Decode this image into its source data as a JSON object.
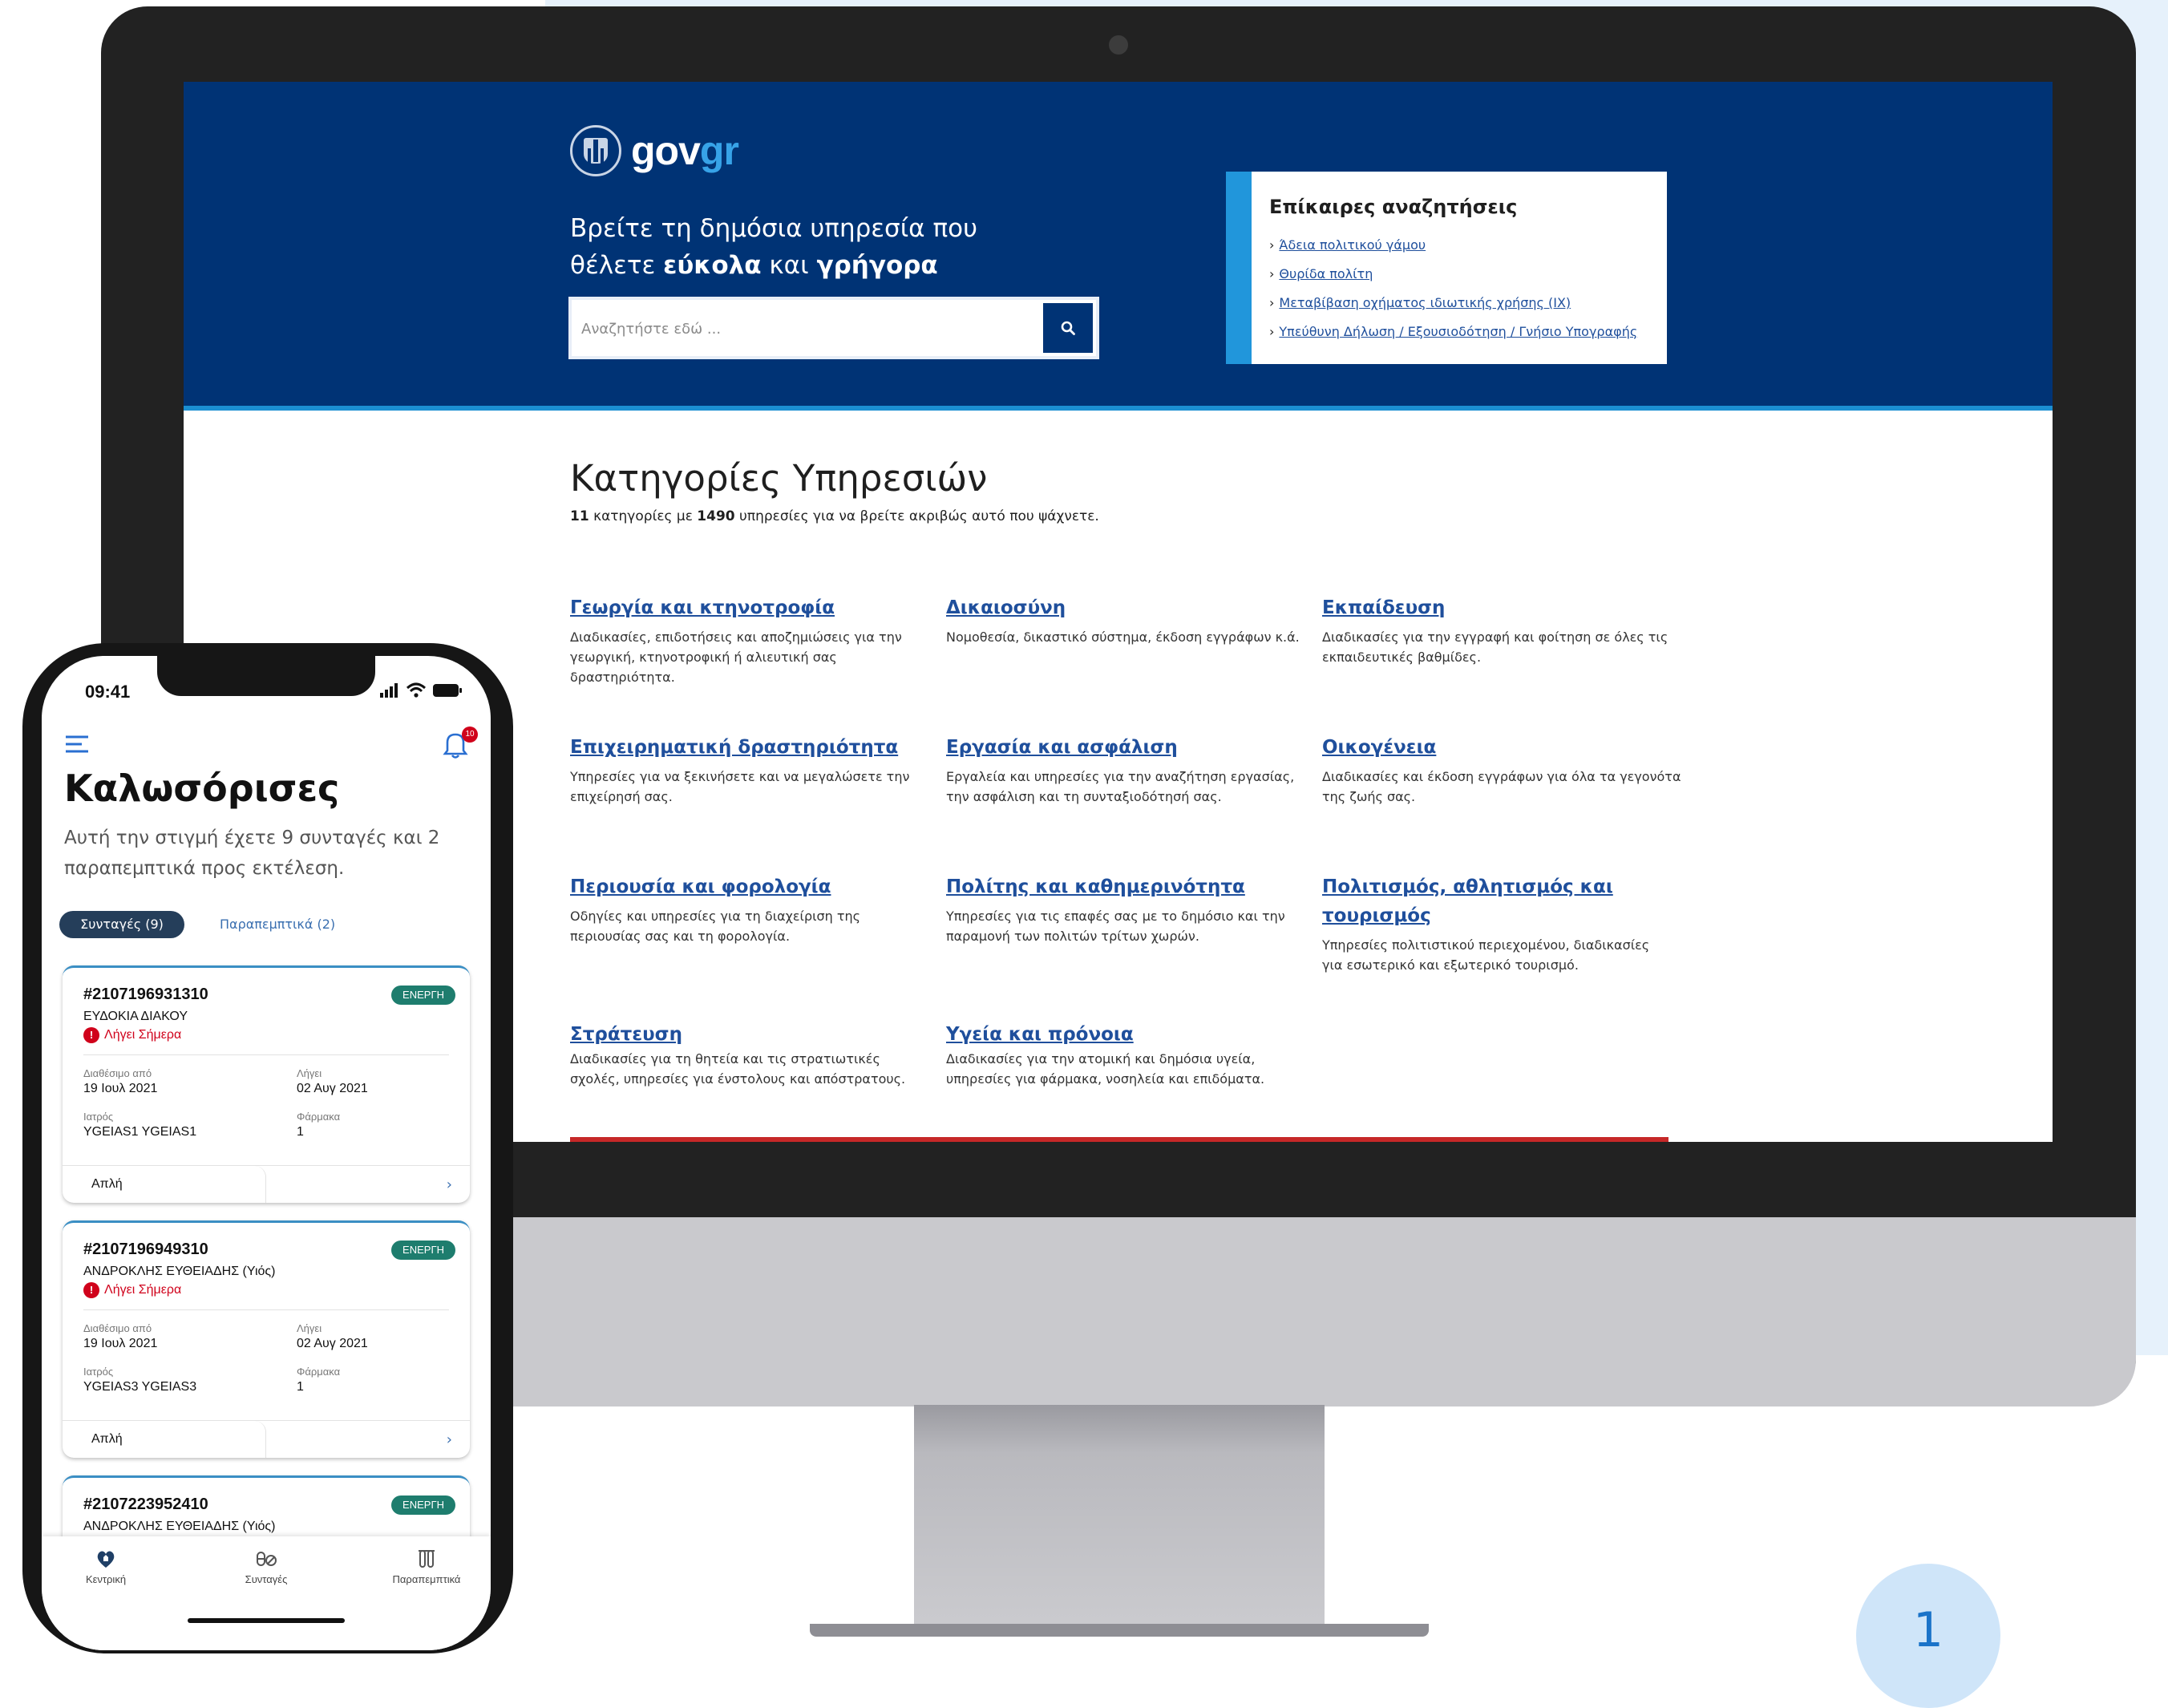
{
  "page_number": "1",
  "desktop": {
    "logo": {
      "gov": "gov",
      "gr": "gr"
    },
    "hero": {
      "line1": "Βρείτε τη δημόσια υπηρεσία που",
      "line2_prefix": "θέλετε ",
      "line2_bold1": "εύκολα",
      "line2_mid": " και ",
      "line2_bold2": "γρήγορα"
    },
    "search": {
      "placeholder": "Αναζητήστε εδώ ..."
    },
    "trending": {
      "title": "Επίκαιρες αναζητήσεις",
      "items": [
        "Άδεια πολιτικού γάμου",
        "Θυρίδα πολίτη",
        "Μεταβίβαση οχήματος ιδιωτικής χρήσης (ΙΧ)",
        "Υπεύθυνη Δήλωση / Εξουσιοδότηση / Γνήσιο Υπογραφής"
      ]
    },
    "categories_title": "Κατηγορίες Υπηρεσιών",
    "categories_sub": {
      "count_categories": "11",
      "part1": " κατηγορίες με ",
      "count_services": "1490",
      "part2": " υπηρεσίες για να βρείτε ακριβώς αυτό που ψάχνετε."
    },
    "categories": [
      {
        "title": "Γεωργία και κτηνοτροφία",
        "desc": "Διαδικασίες, επιδοτήσεις και αποζημιώσεις για την γεωργική, κτηνοτροφική ή αλιευτική σας δραστηριότητα."
      },
      {
        "title": "Δικαιοσύνη",
        "desc": "Νομοθεσία, δικαστικό σύστημα, έκδοση εγγράφων κ.ά."
      },
      {
        "title": "Εκπαίδευση",
        "desc": "Διαδικασίες για την εγγραφή και φοίτηση σε όλες τις εκπαιδευτικές βαθμίδες."
      },
      {
        "title": "Επιχειρηματική δραστηριότητα",
        "desc": "Υπηρεσίες για να ξεκινήσετε και να μεγαλώσετε την επιχείρησή σας."
      },
      {
        "title": "Εργασία και ασφάλιση",
        "desc": "Εργαλεία και υπηρεσίες για την αναζήτηση εργασίας, την ασφάλιση και τη συνταξιοδότησή σας."
      },
      {
        "title": "Οικογένεια",
        "desc": "Διαδικασίες και έκδοση εγγράφων για όλα τα γεγονότα της ζωής σας."
      },
      {
        "title": "Περιουσία και φορολογία",
        "desc": "Οδηγίες και υπηρεσίες για τη διαχείριση της περιουσίας σας και τη φορολογία."
      },
      {
        "title": "Πολίτης και καθημερινότητα",
        "desc": "Υπηρεσίες για τις επαφές σας με το δημόσιο και την παραμονή των πολιτών τρίτων χωρών."
      },
      {
        "title": "Πολιτισμός, αθλητισμός και τουρισμός",
        "desc": "Υπηρεσίες πολιτιστικού περιεχομένου, διαδικασίες για εσωτερικό και εξωτερικό τουρισμό."
      },
      {
        "title": "Στράτευση",
        "desc": "Διαδικασίες για τη θητεία και τις στρατιωτικές σχολές, υπηρεσίες για ένστολους και απόστρατους."
      },
      {
        "title": "Υγεία και πρόνοια",
        "desc": "Διαδικασίες για την ατομική και δημόσια υγεία, υπηρεσίες για φάρμακα, νοσηλεία και επιδόματα."
      }
    ]
  },
  "mobile": {
    "status_time": "09:41",
    "notification_count": "10",
    "welcome": "Καλωσόρισες",
    "welcome_sub": "Αυτή την στιγμή έχετε 9 συνταγές και 2 παραπεμπτικά προς εκτέλεση.",
    "tabs": {
      "active": "Συνταγές (9)",
      "inactive": "Παραπεμπτικά (2)"
    },
    "labels": {
      "available_from": "Διαθέσιμο από",
      "expires": "Λήγει",
      "doctor": "Ιατρός",
      "drugs": "Φάρμακα"
    },
    "prescriptions": [
      {
        "id": "#2107196931310",
        "status": "ΕΝΕΡΓΗ",
        "patient": "ΕΥΔΟΚΙΑ ΔΙΑΚΟΥ",
        "expiry_note": "Λήγει Σήμερα",
        "available_from": "19 Ιουλ 2021",
        "expires": "02 Αυγ 2021",
        "doctor": "YGEIAS1 YGEIAS1",
        "drugs": "1",
        "type": "Απλή"
      },
      {
        "id": "#2107196949310",
        "status": "ΕΝΕΡΓΗ",
        "patient": "ΑΝΔΡΟΚΛΗΣ ΕΥΘΕΙΑΔΗΣ  (Υιός)",
        "expiry_note": "Λήγει Σήμερα",
        "available_from": "19 Ιουλ 2021",
        "expires": "02 Αυγ 2021",
        "doctor": "YGEIAS3 YGEIAS3",
        "drugs": "1",
        "type": "Απλή"
      },
      {
        "id": "#2107223952410",
        "status": "ΕΝΕΡΓΗ",
        "patient": "ΑΝΔΡΟΚΛΗΣ ΕΥΘΕΙΑΔΗΣ  (Υιός)"
      }
    ],
    "tabbar": [
      {
        "label": "Κεντρική",
        "icon": "home-heart-icon"
      },
      {
        "label": "Συνταγές",
        "icon": "pills-icon"
      },
      {
        "label": "Παραπεμπτικά",
        "icon": "test-tubes-icon"
      }
    ]
  }
}
